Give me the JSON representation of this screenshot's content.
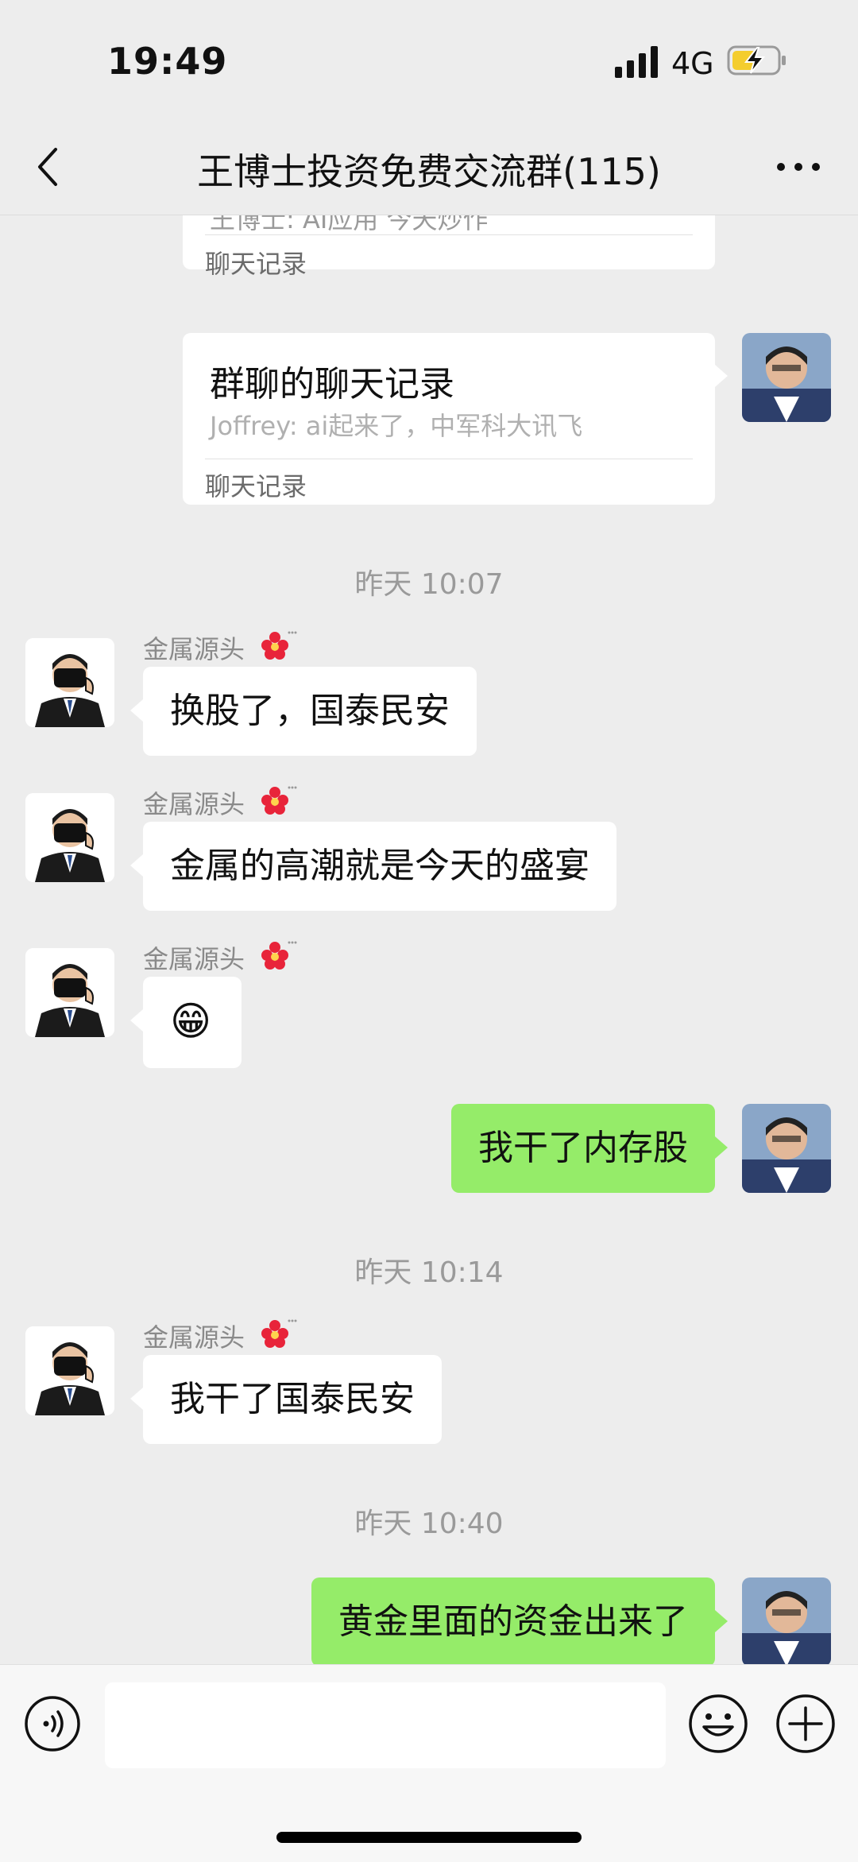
{
  "status": {
    "time": "19:49",
    "network": "4G"
  },
  "header": {
    "title": "王博士投资免费交流群(115)"
  },
  "records": [
    {
      "title_partial": "王博士: AI应用 今天炒作",
      "footer": "聊天记录"
    },
    {
      "title": "群聊的聊天记录",
      "subtitle": "Joffrey: ai起来了，中军科大讯飞",
      "footer": "聊天记录"
    }
  ],
  "timestamps": [
    "昨天 10:07",
    "昨天 10:14",
    "昨天 10:40"
  ],
  "messages": [
    {
      "sender": "金属源头",
      "text": "换股了，国泰民安"
    },
    {
      "sender": "金属源头",
      "text": "金属的高潮就是今天的盛宴"
    },
    {
      "sender": "金属源头",
      "text": "😁"
    },
    {
      "sender": "me",
      "text": "我干了内存股"
    },
    {
      "sender": "金属源头",
      "text": "我干了国泰民安"
    },
    {
      "sender": "me",
      "text": "黄金里面的资金出来了"
    }
  ],
  "colors": {
    "bg": "#ededed",
    "out_bubble": "#95ec69",
    "in_bubble": "#ffffff"
  }
}
